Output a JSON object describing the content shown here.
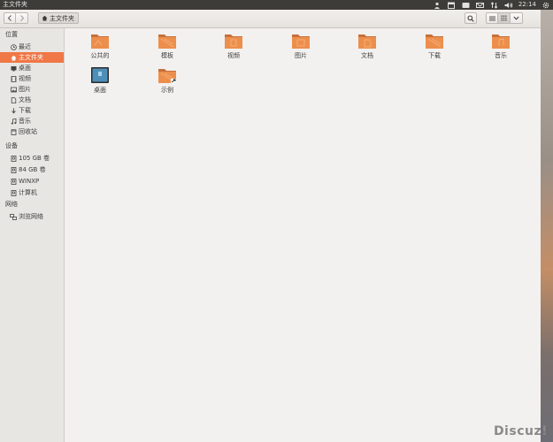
{
  "window": {
    "title": "主文件夹"
  },
  "panel": {
    "clock": "22:14"
  },
  "toolbar": {
    "back_icon": "chevron-left-icon",
    "forward_icon": "chevron-right-icon",
    "path_label": "主文件夹",
    "search_icon": "search-icon",
    "list_view_icon": "list-view-icon",
    "grid_view_icon": "grid-view-icon",
    "menu_icon": "chevron-down-icon"
  },
  "sidebar": {
    "places_title": "位置",
    "places": [
      {
        "label": "最近",
        "icon": "clock-icon"
      },
      {
        "label": "主文件夹",
        "icon": "home-icon",
        "active": true
      },
      {
        "label": "桌面",
        "icon": "desktop-icon"
      },
      {
        "label": "视频",
        "icon": "video-icon"
      },
      {
        "label": "图片",
        "icon": "picture-icon"
      },
      {
        "label": "文档",
        "icon": "document-icon"
      },
      {
        "label": "下载",
        "icon": "download-icon"
      },
      {
        "label": "音乐",
        "icon": "music-icon"
      },
      {
        "label": "回收站",
        "icon": "trash-icon"
      }
    ],
    "devices_title": "设备",
    "devices": [
      {
        "label": "105 GB 卷",
        "icon": "drive-icon"
      },
      {
        "label": "84 GB 卷",
        "icon": "drive-icon"
      },
      {
        "label": "WINXP",
        "icon": "drive-icon"
      },
      {
        "label": "计算机",
        "icon": "drive-icon"
      }
    ],
    "network_title": "网络",
    "network": [
      {
        "label": "浏览网络",
        "icon": "network-icon"
      }
    ]
  },
  "files": [
    {
      "name": "公共的",
      "type": "folder"
    },
    {
      "name": "模板",
      "type": "folder"
    },
    {
      "name": "视频",
      "type": "folder"
    },
    {
      "name": "图片",
      "type": "folder"
    },
    {
      "name": "文档",
      "type": "folder"
    },
    {
      "name": "下载",
      "type": "folder"
    },
    {
      "name": "音乐",
      "type": "folder"
    },
    {
      "name": "桌面",
      "type": "desktop"
    },
    {
      "name": "示例",
      "type": "folder-link"
    }
  ],
  "watermark": "Discuz!",
  "colors": {
    "accent": "#f07746",
    "folder": "#e8884a",
    "panel": "#3d3c38"
  }
}
